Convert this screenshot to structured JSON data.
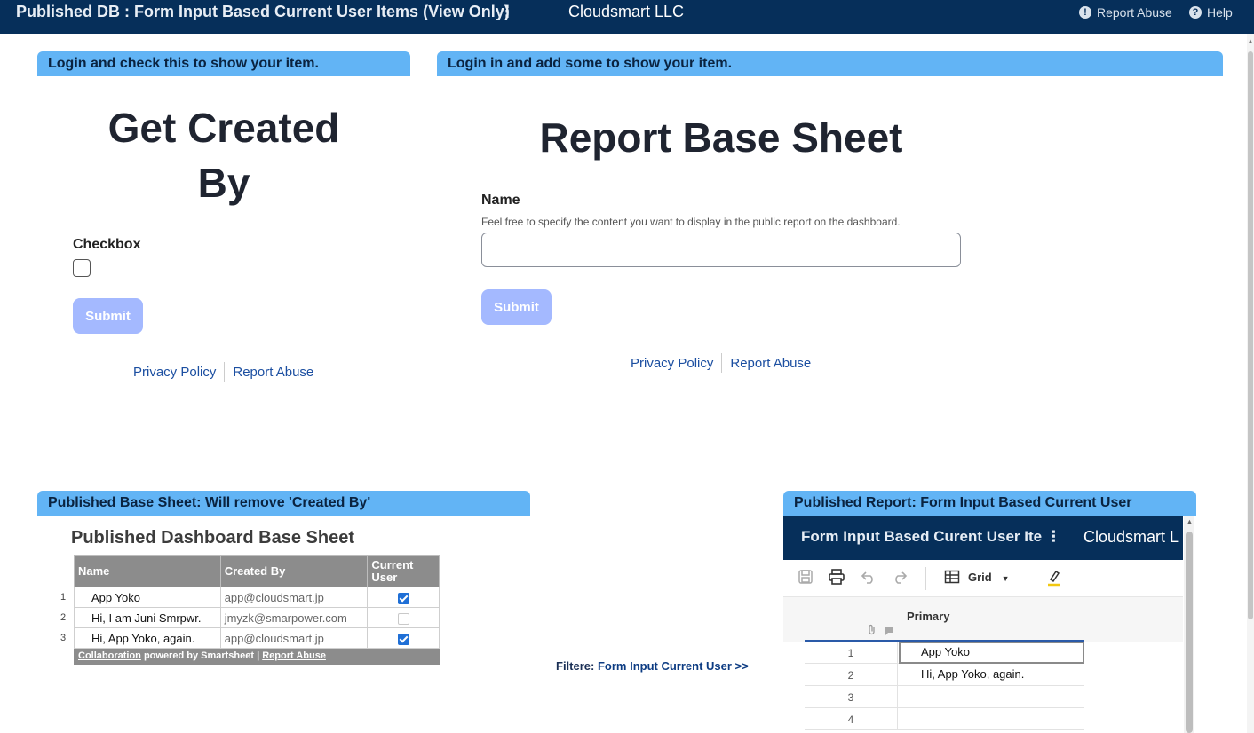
{
  "topbar": {
    "title": "Published DB : Form Input Based Current User Items (View Only)",
    "kebab": "⋮",
    "org": "Cloudsmart LLC",
    "report_abuse": "Report Abuse",
    "help": "Help"
  },
  "widget_left": {
    "band": "Login and check this to show your item.",
    "title": "Get Created By",
    "field_label": "Checkbox",
    "submit": "Submit",
    "privacy": "Privacy Policy",
    "report": "Report Abuse"
  },
  "widget_right": {
    "band": "Login in and add some to show your item.",
    "title": "Report Base Sheet",
    "field_label": "Name",
    "field_help": "Feel free to specify the content you want to display in the public report on the dashboard.",
    "field_value": "",
    "submit": "Submit",
    "privacy": "Privacy Policy",
    "report": "Report Abuse"
  },
  "base_sheet": {
    "band": "Published Base Sheet: Will remove 'Created By'",
    "title": "Published Dashboard Base Sheet",
    "columns": [
      "Name",
      "Created By",
      "Current User"
    ],
    "rows": [
      {
        "num": "1",
        "name": "App Yoko",
        "created_by": "app@cloudsmart.jp",
        "current_user": true
      },
      {
        "num": "2",
        "name": "Hi, I am Juni Smrpwr.",
        "created_by": "jmyzk@smarpower.com",
        "current_user": false
      },
      {
        "num": "3",
        "name": "Hi, App Yoko, again.",
        "created_by": "app@cloudsmart.jp",
        "current_user": true
      }
    ],
    "footer_link": "Collaboration",
    "footer_text": " powered by Smartsheet  |  ",
    "footer_report": "Report Abuse"
  },
  "filter": {
    "label": "Filtere: ",
    "link": "Form Input Current User >>"
  },
  "report_widget": {
    "band": "Published Report: Form Input Based Current User",
    "embed_title": "Form Input Based Curent User Ite",
    "embed_kebab": "⋮",
    "embed_org": "Cloudsmart L",
    "view_label": "Grid",
    "primary_col": "Primary",
    "rows": [
      {
        "num": "1",
        "value": "App Yoko"
      },
      {
        "num": "2",
        "value": "Hi, App Yoko, again."
      },
      {
        "num": "3",
        "value": ""
      },
      {
        "num": "4",
        "value": ""
      }
    ]
  },
  "colors": {
    "topbar": "#062f5a",
    "band": "#62b4f5",
    "submit": "#a4b9ff",
    "link": "#1c4fa1",
    "check": "#1f6fd6"
  }
}
